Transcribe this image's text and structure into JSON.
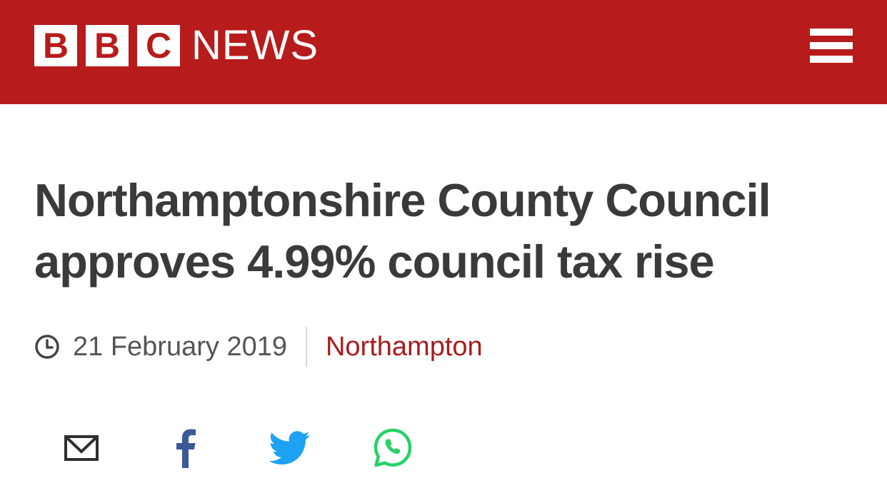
{
  "header": {
    "logo_letters": [
      "B",
      "B",
      "C"
    ],
    "logo_word": "NEWS",
    "brand_color": "#b81b1b",
    "menu_icon": "hamburger-menu-icon"
  },
  "article": {
    "headline": "Northamptonshire County Council approves 4.99% council tax rise",
    "date": "21 February 2019",
    "section": "Northampton",
    "section_color": "#a81c1c"
  },
  "share": {
    "icons": [
      "email-icon",
      "facebook-icon",
      "twitter-icon",
      "whatsapp-icon"
    ]
  }
}
